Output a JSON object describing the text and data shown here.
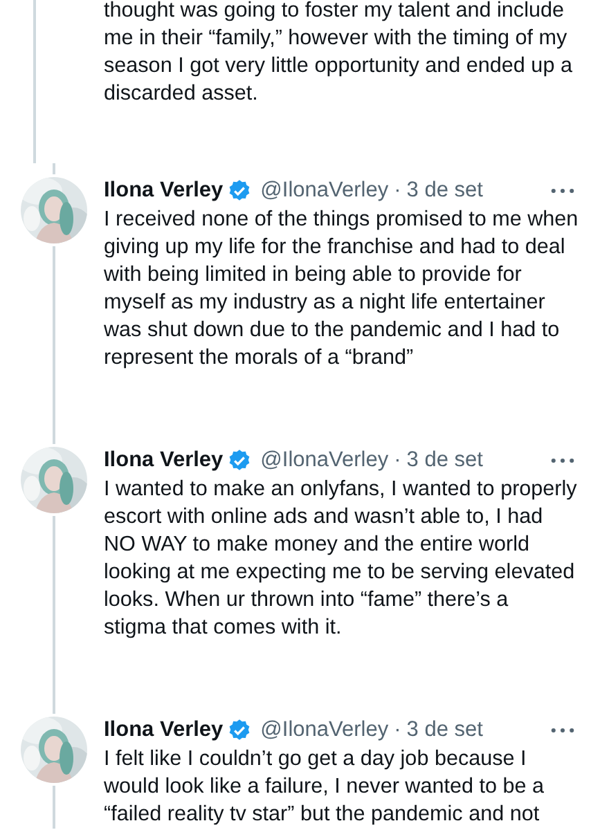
{
  "tweets": [
    {
      "kind": "continuation",
      "text": "thought was going to foster my talent and include\nme in their “family,” however with the timing of my\nseason I got very little opportunity and ended up a\ndiscarded asset."
    },
    {
      "kind": "tweet",
      "name": "Ilona Verley",
      "verified": true,
      "handle": "@IlonaVerley",
      "separator": "·",
      "date": "3 de set",
      "text": "I received none of the things promised to me when\ngiving up my life for the franchise and had to deal\nwith being limited in being able to provide for\nmyself as my industry as a night life entertainer\nwas shut down due to the pandemic and I had to\nrepresent the morals of a “brand”"
    },
    {
      "kind": "tweet",
      "name": "Ilona Verley",
      "verified": true,
      "handle": "@IlonaVerley",
      "separator": "·",
      "date": "3 de set",
      "text": "I wanted to make an onlyfans, I wanted to properly\nescort with online ads and wasn’t able to, I had\nNO WAY to make money and the entire world\nlooking at me expecting me to be serving elevated\nlooks. When ur thrown into “fame” there’s a\nstigma that comes with it."
    },
    {
      "kind": "tweet",
      "name": "Ilona Verley",
      "verified": true,
      "handle": "@IlonaVerley",
      "separator": "·",
      "date": "3 de set",
      "text": "I felt like I couldn’t go get a day job because I\nwould look like a failure, I never wanted to be a\n“failed reality tv star” but the pandemic and not"
    }
  ]
}
